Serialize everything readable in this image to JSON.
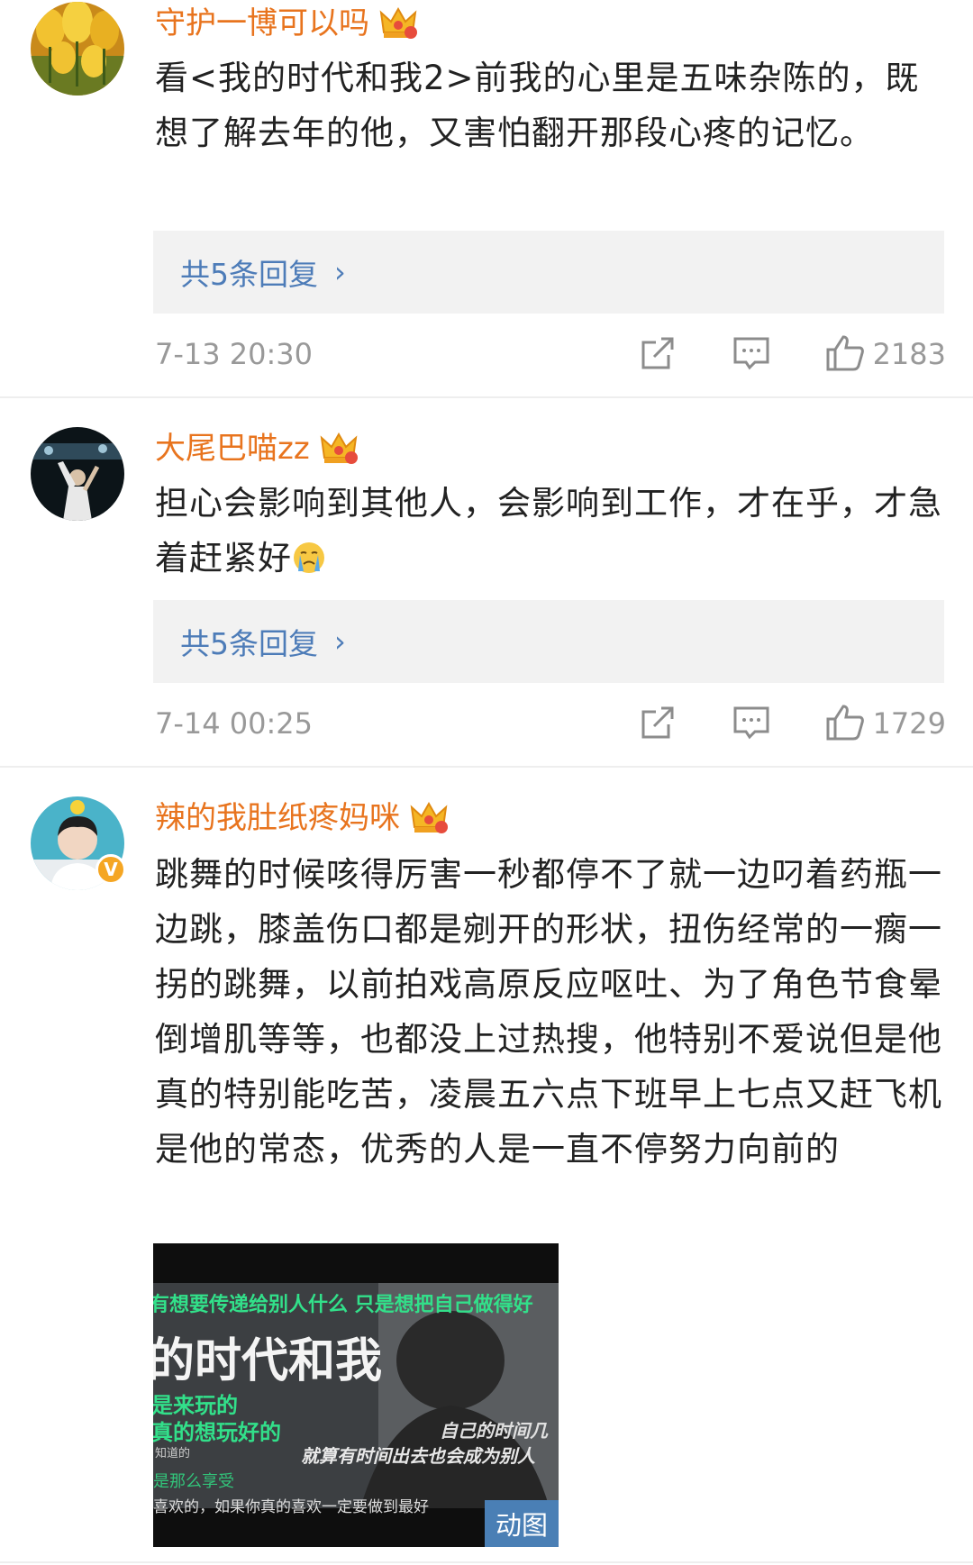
{
  "comments": [
    {
      "username": "守护一博可以吗",
      "text": "看<我的时代和我2>前我的心里是五味杂陈的，既想了解去年的他，又害怕翻开那段心疼的记忆。",
      "replies": "共5条回复",
      "time": "7-13 20:30",
      "likes": "2183"
    },
    {
      "username": "大尾巴喵zz",
      "text": "担心会影响到其他人，会影响到工作，才在乎，才急着赶紧好",
      "replies": "共5条回复",
      "time": "7-14 00:25",
      "likes": "1729"
    },
    {
      "username": "辣的我肚纸疼妈咪",
      "text": "跳舞的时候咳得厉害一秒都停不了就一边叼着药瓶一边跳，膝盖伤口都是剜开的形状，扭伤经常的一瘸一拐的跳舞，以前拍戏高原反应呕吐、为了角色节食晕倒增肌等等，也都没上过热搜，他特别不爱说但是他真的特别能吃苦，凌晨五六点下班早上七点又赶飞机是他的常态，优秀的人是一直不停努力向前的",
      "gif_badge": "动图",
      "gif_texts": {
        "line1": "有想要传递给别人什么 只是想把自己做得好",
        "title": "的时代和我",
        "line3": "是来玩的",
        "line4": "真的想玩好的",
        "line5": "自己的时间几",
        "line6": "就算有时间出去也会成为别人",
        "line7": "知道的",
        "line8": "是那么享受",
        "line9": "喜欢的，如果你真的喜欢一定要做到最好"
      }
    }
  ],
  "icons": {
    "reply_arrow": "chevron-right-icon",
    "share": "share-icon",
    "comment": "comment-icon",
    "like": "thumbs-up-icon",
    "crown": "crown-badge-icon",
    "crying": "crying-emoji-icon",
    "verified": "verified-v-icon"
  },
  "colors": {
    "username": "#e8741e",
    "link": "#4d7cb8",
    "meta": "#999999",
    "reply_bg": "#f2f2f2"
  }
}
